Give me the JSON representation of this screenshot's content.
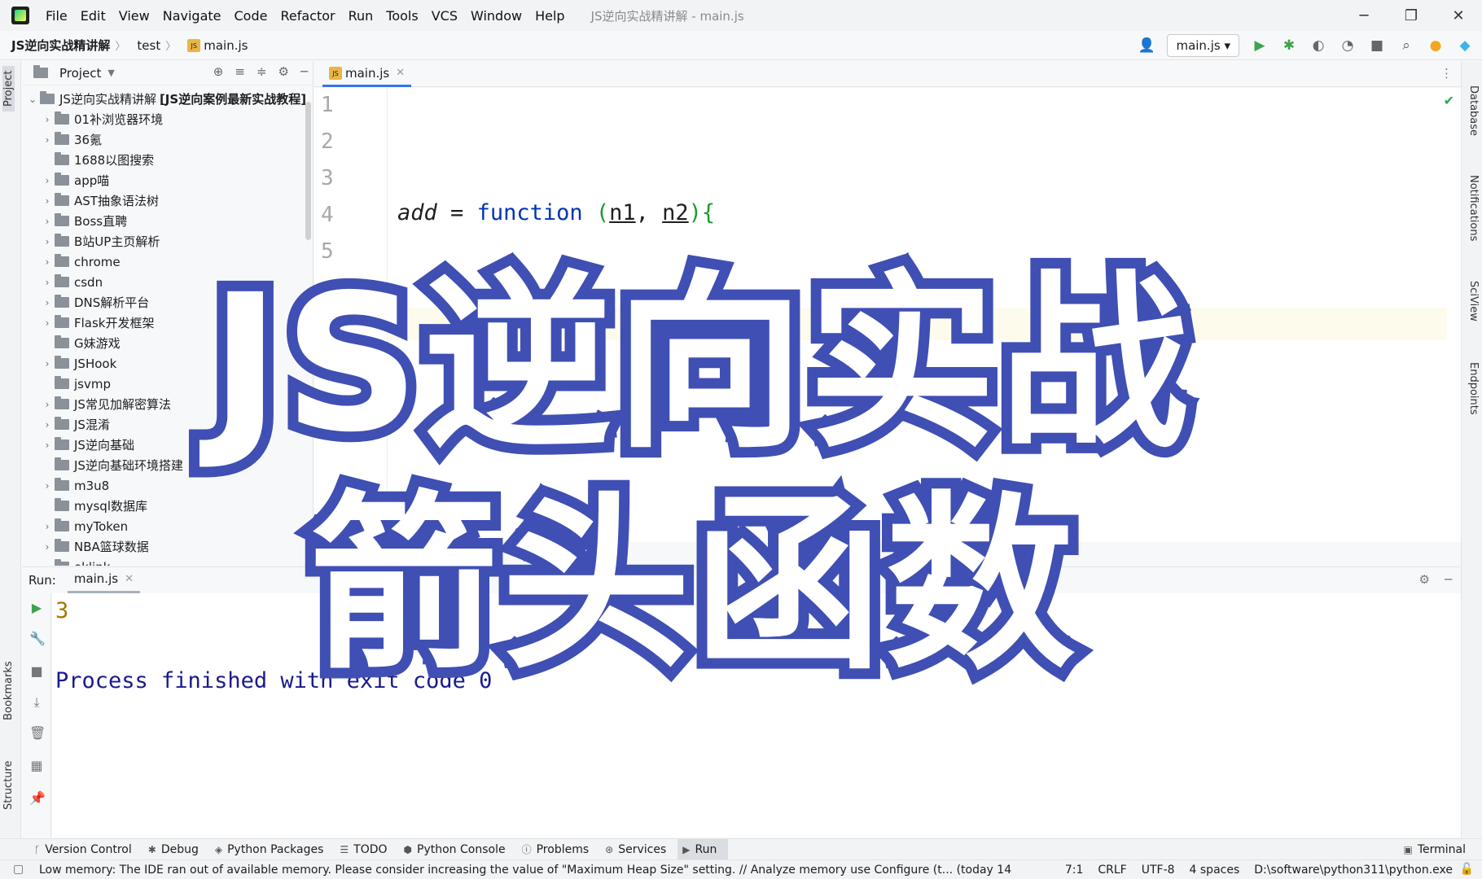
{
  "titlebar": {
    "menu": [
      "File",
      "Edit",
      "View",
      "Navigate",
      "Code",
      "Refactor",
      "Run",
      "Tools",
      "VCS",
      "Window",
      "Help"
    ],
    "title": "JS逆向实战精讲解 - main.js",
    "minimize": "─",
    "restore": "❐",
    "close": "✕"
  },
  "navbar": {
    "project": "JS逆向实战精讲解",
    "folder": "test",
    "file": "main.js",
    "file_icon": "JS",
    "run_config": "main.js"
  },
  "left_strip": {
    "project_tab": "Project",
    "bookmarks_tab": "Bookmarks",
    "structure_tab": "Structure"
  },
  "right_strip": {
    "database_tab": "Database",
    "notifications_tab": "Notifications",
    "sciview_tab": "SciView",
    "endpoints_tab": "Endpoints"
  },
  "project_panel": {
    "title": "Project",
    "root_name": "JS逆向实战精讲解",
    "root_extra": "[JS逆向案例最新实战教程]",
    "items": [
      {
        "label": "01补浏览器环境",
        "chevron": "›"
      },
      {
        "label": "36氪",
        "chevron": "›"
      },
      {
        "label": "1688以图搜索",
        "chevron": ""
      },
      {
        "label": "app喵",
        "chevron": "›"
      },
      {
        "label": "AST抽象语法树",
        "chevron": "›"
      },
      {
        "label": "Boss直聘",
        "chevron": "›"
      },
      {
        "label": "B站UP主页解析",
        "chevron": "›"
      },
      {
        "label": "chrome",
        "chevron": "›"
      },
      {
        "label": "csdn",
        "chevron": "›"
      },
      {
        "label": "DNS解析平台",
        "chevron": "›"
      },
      {
        "label": "Flask开发框架",
        "chevron": "›"
      },
      {
        "label": "G妹游戏",
        "chevron": ""
      },
      {
        "label": "JSHook",
        "chevron": "›"
      },
      {
        "label": "jsvmp",
        "chevron": ""
      },
      {
        "label": "JS常见加解密算法",
        "chevron": "›"
      },
      {
        "label": "JS混淆",
        "chevron": "›"
      },
      {
        "label": "JS逆向基础",
        "chevron": "›"
      },
      {
        "label": "JS逆向基础环境搭建",
        "chevron": ""
      },
      {
        "label": "m3u8",
        "chevron": "›"
      },
      {
        "label": "mysql数据库",
        "chevron": ""
      },
      {
        "label": "myToken",
        "chevron": "›"
      },
      {
        "label": "NBA篮球数据",
        "chevron": "›"
      },
      {
        "label": "oklink",
        "chevron": ""
      }
    ]
  },
  "editor": {
    "tab": "main.js",
    "tab_icon": "JS",
    "line_numbers": [
      "1",
      "2",
      "3",
      "4",
      "5"
    ],
    "code": {
      "fn_name": "add",
      "assign": " = ",
      "keyword": "function",
      "open": " (",
      "p1": "n1",
      "comma": ", ",
      "p2": "n2",
      "close": "){"
    }
  },
  "run_panel": {
    "label": "Run:",
    "tab": "main.js",
    "output_value": "3",
    "output_message": "Process finished with exit code 0"
  },
  "bottom_tools": {
    "items": [
      "Version Control",
      "Debug",
      "Python Packages",
      "TODO",
      "Python Console",
      "Problems",
      "Services",
      "Run"
    ],
    "terminal": "Terminal"
  },
  "statusbar": {
    "message": "Low memory: The IDE ran out of available memory. Please consider increasing the value of \"Maximum Heap Size\" setting. // Analyze memory use   Configure (t... (today 14",
    "position": "7:1",
    "line_sep": "CRLF",
    "encoding": "UTF-8",
    "indent": "4 spaces",
    "interpreter": "D:\\software\\python311\\python.exe"
  },
  "overlay": {
    "line1": "JS逆向实战",
    "line2": "箭头函数"
  },
  "colors": {
    "overlay_stroke": "#3f4fb3",
    "accent": "#3574f0",
    "keyword": "#0033b3"
  }
}
